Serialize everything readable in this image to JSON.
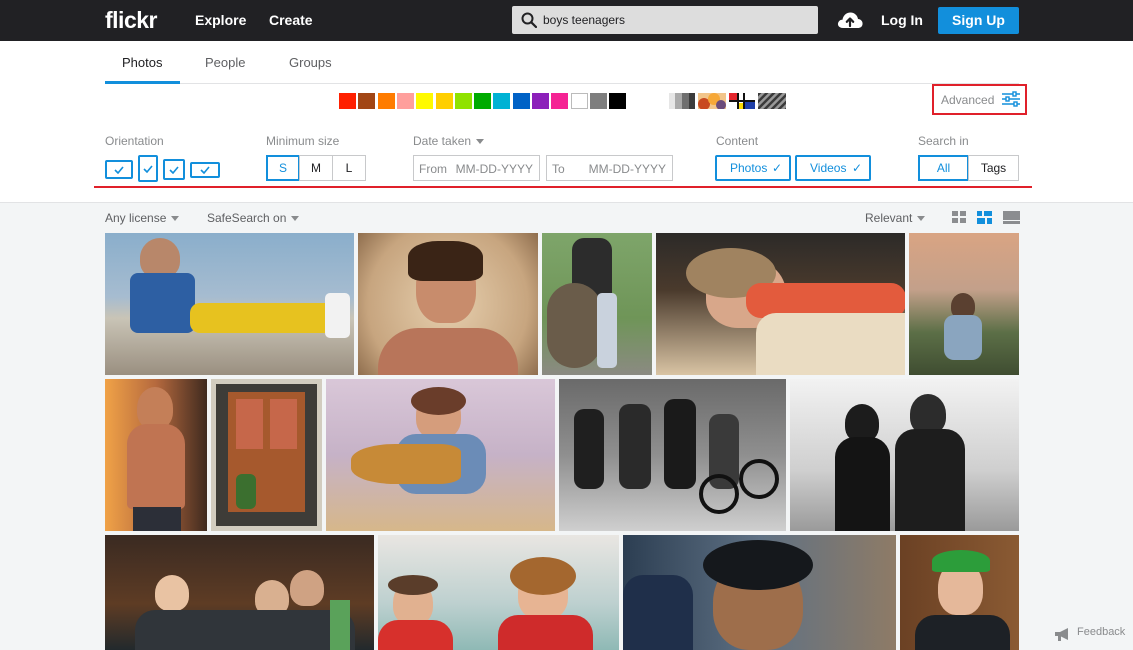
{
  "header": {
    "logo": "flickr",
    "nav": [
      "Explore",
      "Create"
    ],
    "search_value": "boys teenagers",
    "login": "Log In",
    "signup": "Sign Up"
  },
  "tabs": [
    "Photos",
    "People",
    "Groups"
  ],
  "active_tab": "Photos",
  "colors": [
    "#ff2000",
    "#a24615",
    "#ff7c00",
    "#ff9f9c",
    "#fffa00",
    "#ffcf00",
    "#90e200",
    "#00ab00",
    "#00b2d4",
    "#0062c6",
    "#8c20ba",
    "#f52394",
    "#ffffff",
    "#7e7e7e",
    "#000000"
  ],
  "advanced_label": "Advanced",
  "filters": {
    "orientation_label": "Orientation",
    "min_size_label": "Minimum size",
    "sizes": [
      "S",
      "M",
      "L"
    ],
    "selected_size": "S",
    "date_label": "Date taken",
    "date_from_label": "From",
    "date_to_label": "To",
    "date_placeholder": "MM-DD-YYYY",
    "content_label": "Content",
    "content_options": [
      "Photos",
      "Videos"
    ],
    "search_in_label": "Search in",
    "search_in_options": [
      "All",
      "Tags"
    ],
    "search_in_selected": "All"
  },
  "subbar": {
    "license": "Any license",
    "safesearch": "SafeSearch on",
    "sort": "Relevant"
  },
  "feedback": "Feedback"
}
